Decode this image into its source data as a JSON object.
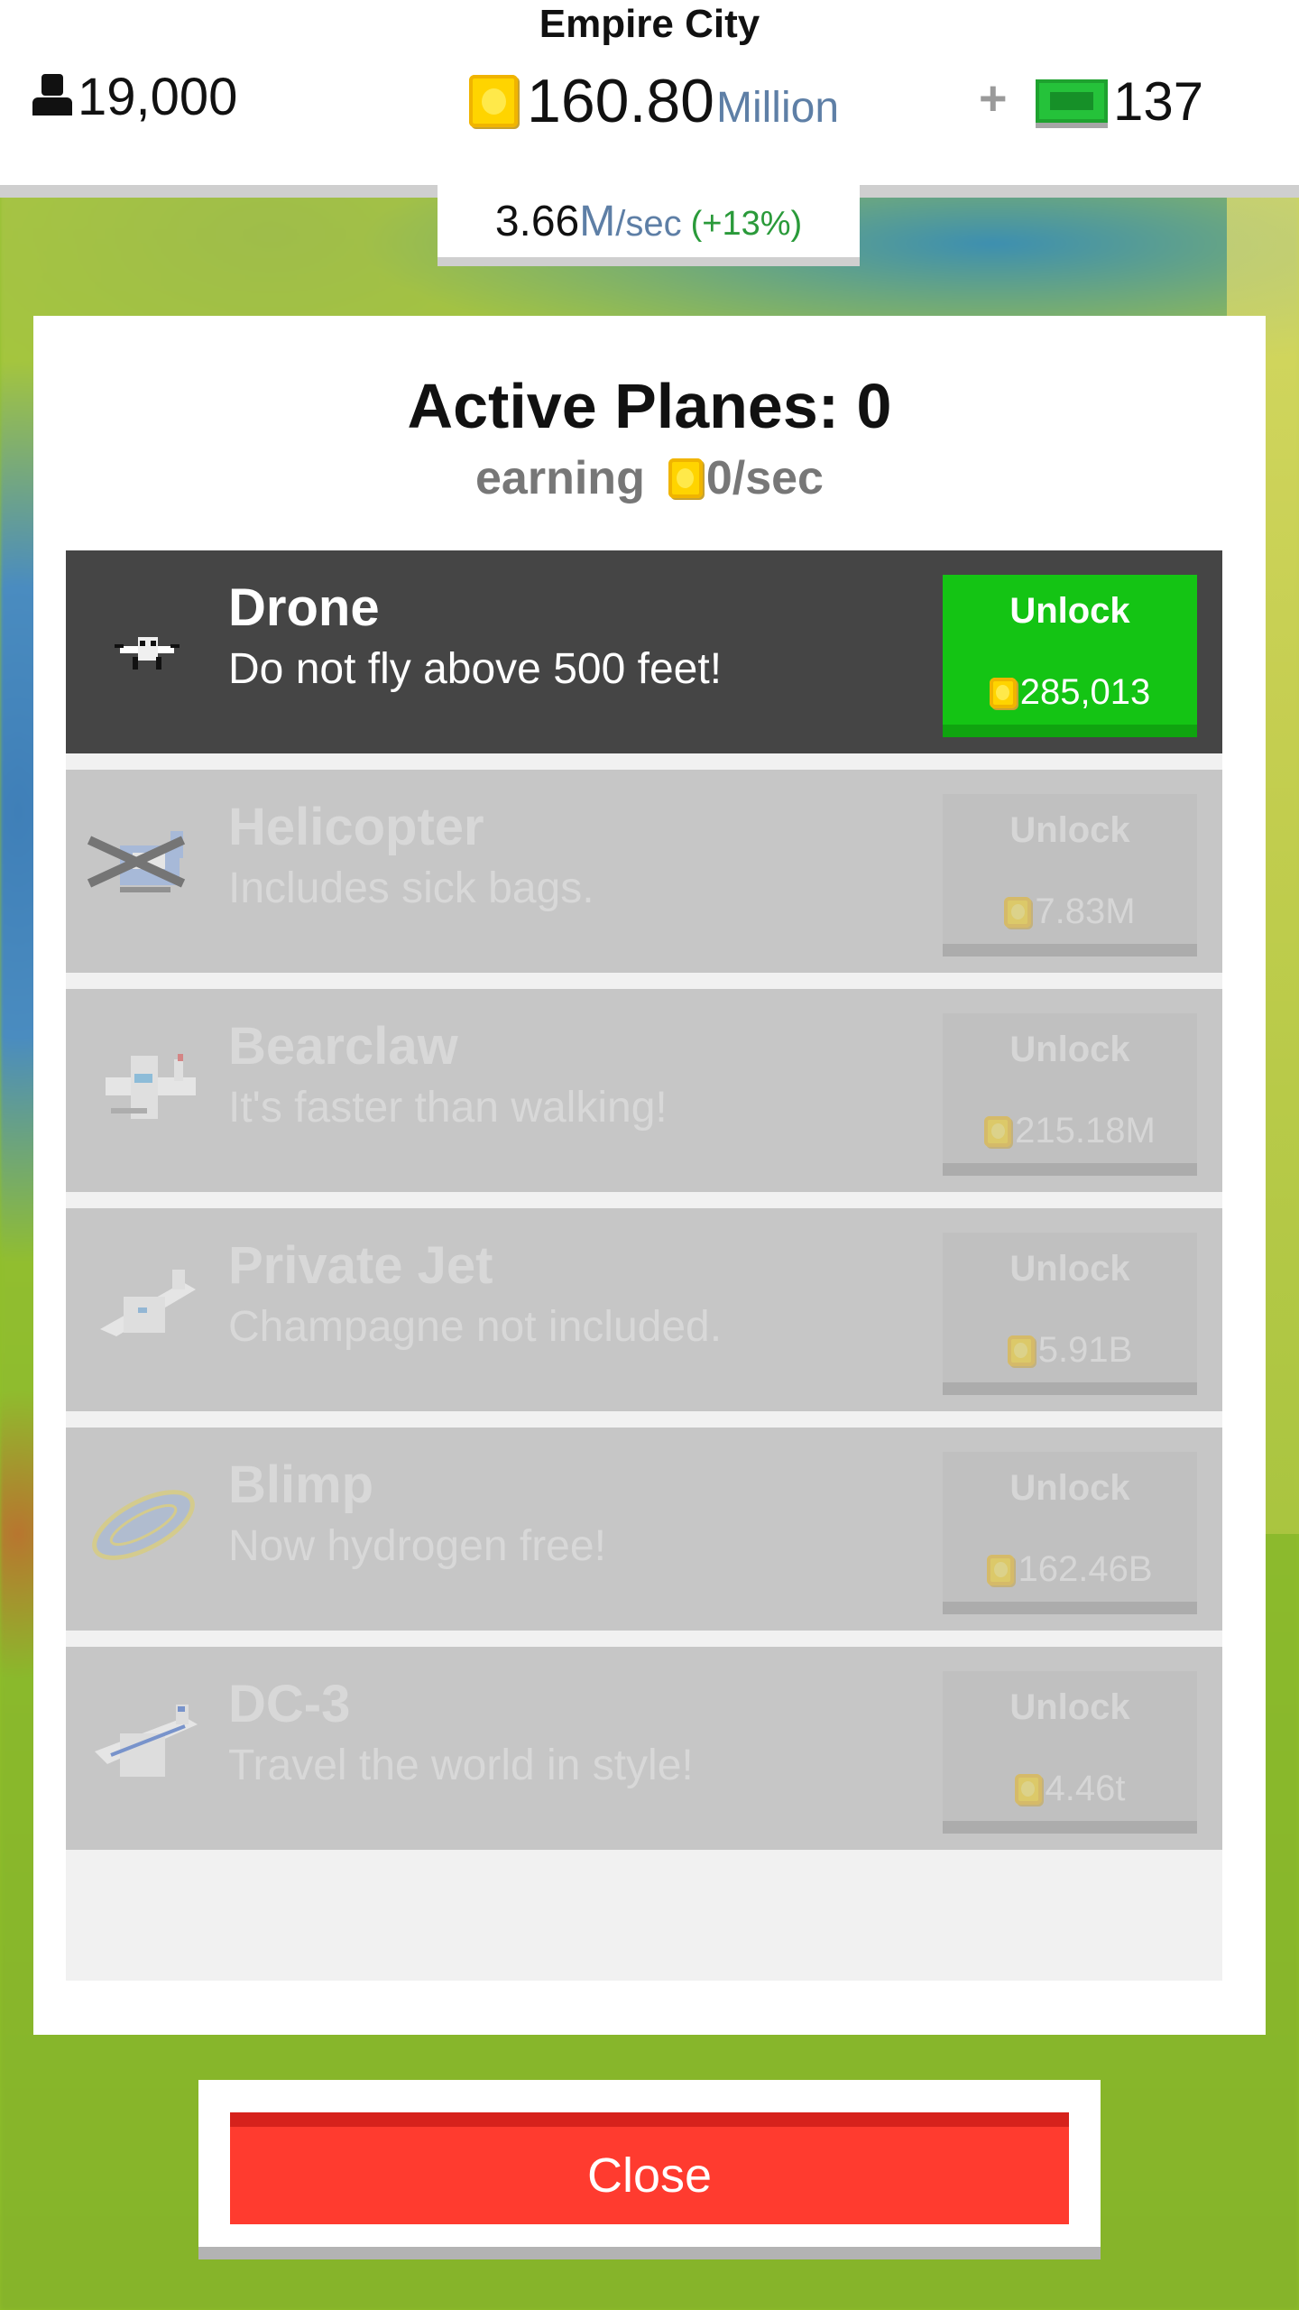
{
  "header": {
    "city_name": "Empire City",
    "population": "19,000",
    "money_value": "160.80",
    "money_unit": "Million",
    "plus_label": "+",
    "bucks_value": "137"
  },
  "income": {
    "value": "3.66",
    "unit": "M",
    "per": "/sec",
    "percent": "(+13%)"
  },
  "panel": {
    "title": "Active Planes: 0",
    "earning_label": "earning",
    "earning_rate": "0/sec"
  },
  "planes": [
    {
      "name": "Drone",
      "desc": "Do not fly above 500 feet!",
      "button": "Unlock",
      "price": "285,013",
      "state": "available",
      "icon": "drone-icon"
    },
    {
      "name": "Helicopter",
      "desc": "Includes sick bags.",
      "button": "Unlock",
      "price": "7.83M",
      "state": "locked",
      "icon": "helicopter-icon"
    },
    {
      "name": "Bearclaw",
      "desc": "It's faster than walking!",
      "button": "Unlock",
      "price": "215.18M",
      "state": "locked",
      "icon": "bearclaw-plane-icon"
    },
    {
      "name": "Private Jet",
      "desc": "Champagne not included.",
      "button": "Unlock",
      "price": "5.91B",
      "state": "locked",
      "icon": "private-jet-icon"
    },
    {
      "name": "Blimp",
      "desc": "Now hydrogen free!",
      "button": "Unlock",
      "price": "162.46B",
      "state": "locked",
      "icon": "blimp-icon"
    },
    {
      "name": "DC-3",
      "desc": "Travel the world in style!",
      "button": "Unlock",
      "price": "4.46t",
      "state": "locked",
      "icon": "dc3-plane-icon"
    }
  ],
  "close_label": "Close",
  "colors": {
    "unlock_green": "#14c414",
    "close_red": "#ff3b2f",
    "coin_gold": "#ffd400",
    "unit_blue": "#5e7fa6",
    "percent_green": "#2a9a3a"
  }
}
